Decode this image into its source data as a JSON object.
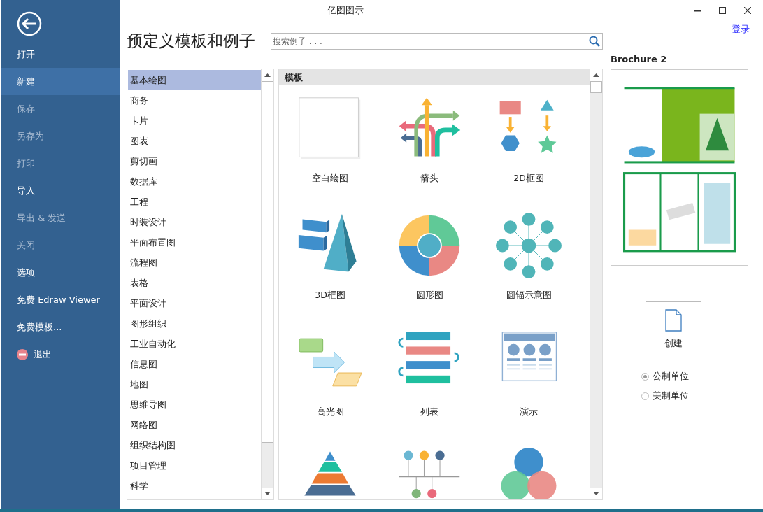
{
  "window": {
    "title": "亿图图示",
    "login_link": "登录"
  },
  "sidebar": {
    "items": [
      {
        "label": "打开",
        "kind": "text",
        "selected": false,
        "disabled": false
      },
      {
        "label": "新建",
        "kind": "text",
        "selected": true,
        "disabled": false
      },
      {
        "label": "保存",
        "kind": "text",
        "selected": false,
        "disabled": true
      },
      {
        "label": "另存为",
        "kind": "text",
        "selected": false,
        "disabled": true
      },
      {
        "label": "打印",
        "kind": "text",
        "selected": false,
        "disabled": true
      },
      {
        "label": "导入",
        "kind": "text",
        "selected": false,
        "disabled": false
      },
      {
        "label": "导出 & 发送",
        "kind": "text",
        "selected": false,
        "disabled": true
      },
      {
        "label": "关闭",
        "kind": "text",
        "selected": false,
        "disabled": true
      },
      {
        "label": "选项",
        "kind": "text",
        "selected": false,
        "disabled": false
      },
      {
        "label": "免费 Edraw Viewer",
        "kind": "text",
        "selected": false,
        "disabled": false
      },
      {
        "label": "免费模板...",
        "kind": "text",
        "selected": false,
        "disabled": false
      },
      {
        "label": "退出",
        "kind": "exit",
        "selected": false,
        "disabled": false
      }
    ]
  },
  "heading": "预定义模板和例子",
  "search": {
    "placeholder": "搜索例子 . . ."
  },
  "categories": [
    {
      "label": "基本绘图",
      "selected": true
    },
    {
      "label": "商务",
      "selected": false
    },
    {
      "label": "卡片",
      "selected": false
    },
    {
      "label": "图表",
      "selected": false
    },
    {
      "label": "剪切画",
      "selected": false
    },
    {
      "label": "数据库",
      "selected": false
    },
    {
      "label": "工程",
      "selected": false
    },
    {
      "label": "时装设计",
      "selected": false
    },
    {
      "label": "平面布置图",
      "selected": false
    },
    {
      "label": "流程图",
      "selected": false
    },
    {
      "label": "表格",
      "selected": false
    },
    {
      "label": "平面设计",
      "selected": false
    },
    {
      "label": "图形组织",
      "selected": false
    },
    {
      "label": "工业自动化",
      "selected": false
    },
    {
      "label": "信息图",
      "selected": false
    },
    {
      "label": "地图",
      "selected": false
    },
    {
      "label": "思维导图",
      "selected": false
    },
    {
      "label": "网络图",
      "selected": false
    },
    {
      "label": "组织结构图",
      "selected": false
    },
    {
      "label": "项目管理",
      "selected": false
    },
    {
      "label": "科学",
      "selected": false
    }
  ],
  "templates": {
    "header": "模板",
    "items": [
      {
        "label": "空白绘图",
        "kind": "blank"
      },
      {
        "label": "箭头",
        "kind": "arrows"
      },
      {
        "label": "2D框图",
        "kind": "block2d"
      },
      {
        "label": "3D框图",
        "kind": "block3d"
      },
      {
        "label": "圆形图",
        "kind": "circle"
      },
      {
        "label": "圆辐示意图",
        "kind": "spoke"
      },
      {
        "label": "高光图",
        "kind": "highlight"
      },
      {
        "label": "列表",
        "kind": "list"
      },
      {
        "label": "演示",
        "kind": "presentation"
      },
      {
        "kind": "pyramid"
      },
      {
        "kind": "timeline"
      },
      {
        "kind": "venn"
      }
    ]
  },
  "preview": {
    "title": "Brochure 2"
  },
  "create_button": {
    "label": "创建"
  },
  "units": [
    {
      "label": "公制单位",
      "selected": true
    },
    {
      "label": "美制单位",
      "selected": false
    }
  ]
}
